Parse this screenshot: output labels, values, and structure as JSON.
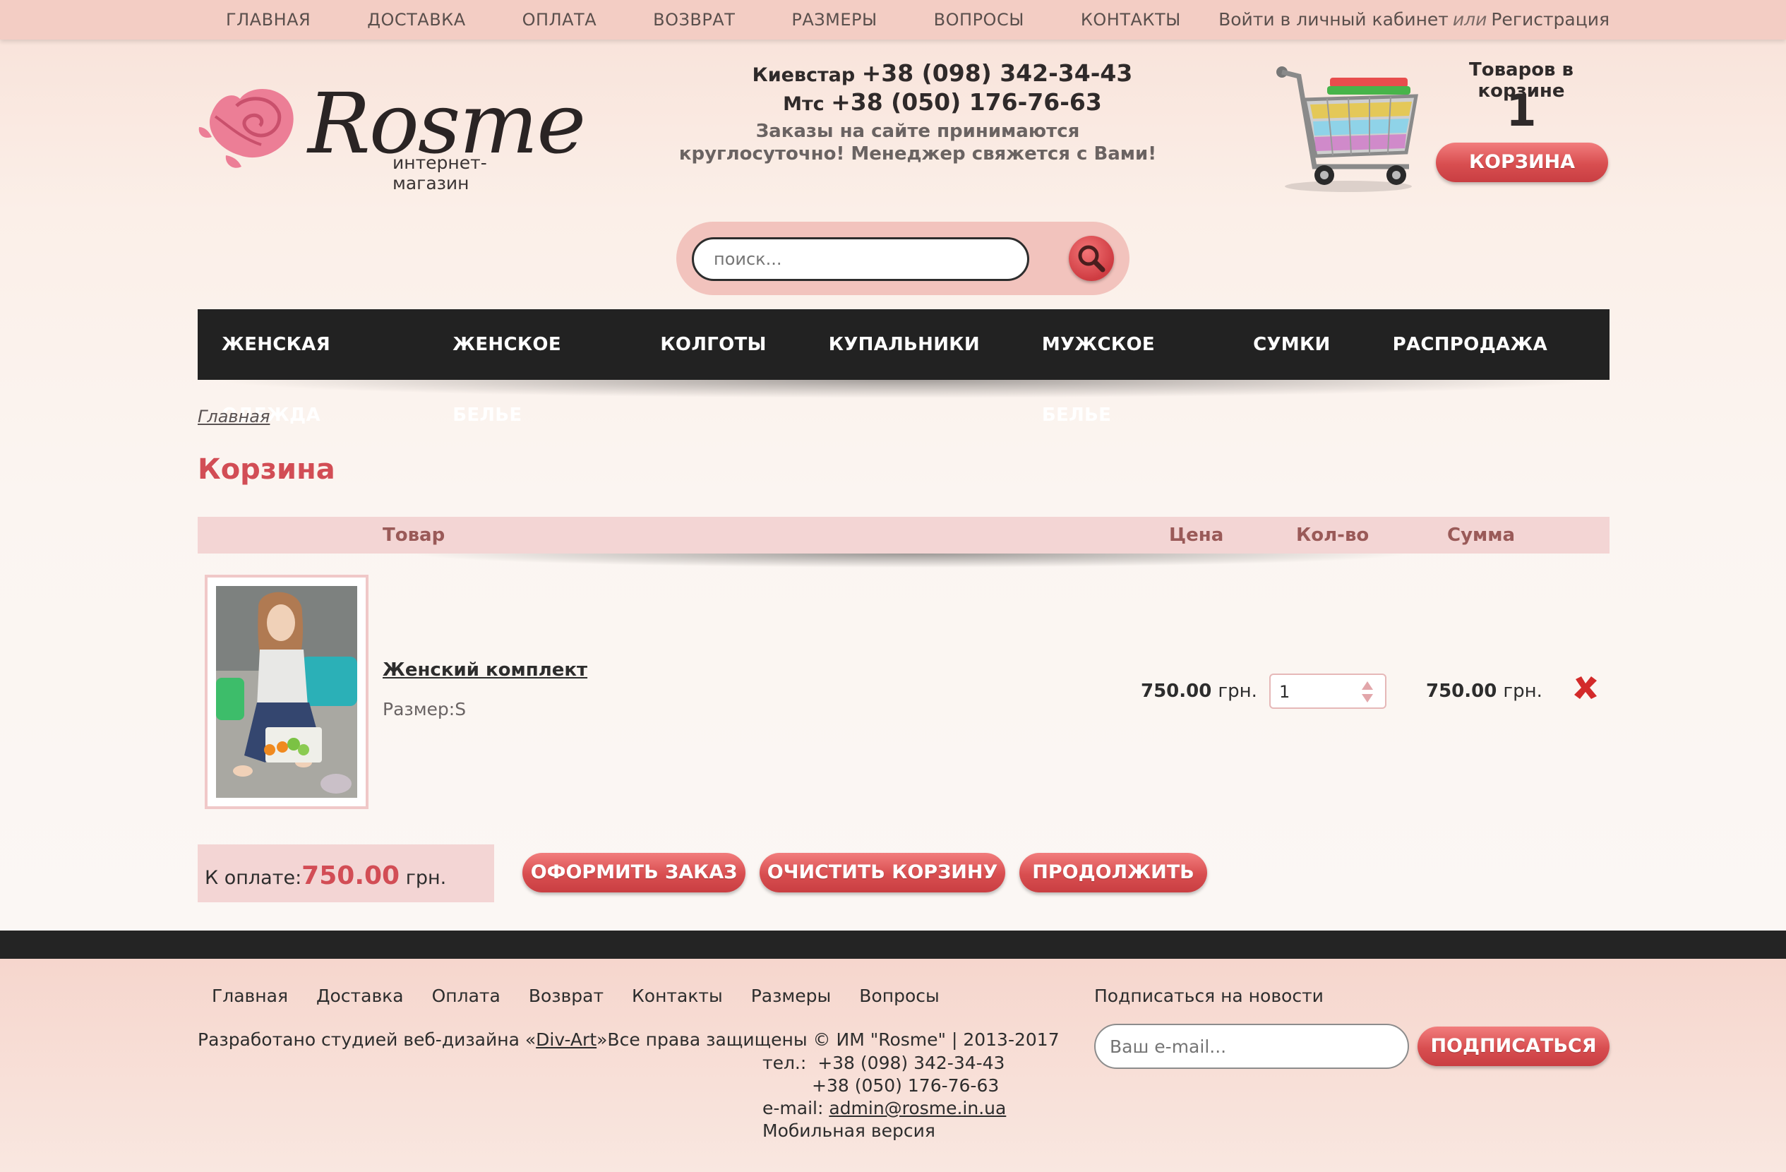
{
  "topnav": {
    "items": [
      "ГЛАВНАЯ",
      "ДОСТАВКА",
      "ОПЛАТА",
      "ВОЗВРАТ",
      "РАЗМЕРЫ",
      "ВОПРОСЫ",
      "КОНТАКТЫ"
    ],
    "login": "Войти в личный кабинет",
    "or": "или",
    "register": "Регистрация"
  },
  "header": {
    "logo_text": "Rosme",
    "logo_sub": "интернет-магазин",
    "phone1_label": "Киевстар",
    "phone1": "+38 (098) 342-34-43",
    "phone2_label": "Мтс",
    "phone2": "+38 (050) 176-76-63",
    "note_line1": "Заказы на сайте принимаются",
    "note_line2": "круглосуточно!  Менеджер свяжется с Вами!",
    "cart_label": "Товаров в корзине",
    "cart_count": "1",
    "cart_button": "КОРЗИНА"
  },
  "search": {
    "placeholder": "поиск..."
  },
  "categories": [
    "ЖЕНСКАЯ ОДЕЖДА",
    "ЖЕНСКОЕ БЕЛЬЕ",
    "КОЛГОТЫ",
    "КУПАЛЬНИКИ",
    "МУЖСКОЕ БЕЛЬЕ",
    "СУМКИ",
    "РАСПРОДАЖА"
  ],
  "breadcrumb": "Главная",
  "page_title": "Корзина",
  "table": {
    "col_product": "Товар",
    "col_price": "Цена",
    "col_qty": "Кол-во",
    "col_sum": "Сумма"
  },
  "item": {
    "name": "Женский комплект",
    "size": "Размер:S",
    "price": "750.00",
    "currency": "грн.",
    "qty": "1",
    "sum": "750.00"
  },
  "totals": {
    "label": "К оплате:",
    "value": "750.00",
    "currency": "грн."
  },
  "buttons": {
    "order": "ОФОРМИТЬ ЗАКАЗ",
    "clear": "ОЧИСТИТЬ КОРЗИНУ",
    "continue": "ПРОДОЛЖИТЬ"
  },
  "footer": {
    "nav": [
      "Главная",
      "Доставка",
      "Оплата",
      "Возврат",
      "Контакты",
      "Размеры",
      "Вопросы"
    ],
    "credits_pre": "Разработано студией веб-дизайна «",
    "credits_link": "Div-Art",
    "credits_post": "»Все права защищены © ИМ \"Rosme\" | 2013-2017",
    "tel_label": "тел.:",
    "tel1": "+38 (098) 342-34-43",
    "tel2": "+38 (050) 176-76-63",
    "email_label": "e-mail:",
    "email": "admin@rosme.in.ua",
    "mobile": "Мобильная версия",
    "subscribe_label": "Подписаться на новости",
    "subscribe_placeholder": "Ваш e-mail...",
    "subscribe_button": "ПОДПИСАТЬСЯ"
  },
  "colors": {
    "accent": "#d24d55",
    "nav_dark": "#222222",
    "topbar": "#f3cdc4",
    "table_header": "#f3d5d4"
  }
}
